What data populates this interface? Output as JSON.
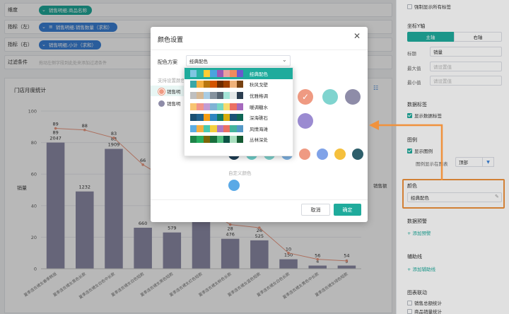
{
  "fields": {
    "dimension": {
      "label": "维度",
      "pill": "销售明细.商品名称"
    },
    "metric_left": {
      "label": "指标（左）",
      "pill": "销售明细.销售数量（求和）"
    },
    "metric_right": {
      "label": "指标（右）",
      "pill": "销售明细.小计（求和）"
    },
    "filter": {
      "label": "过滤条件",
      "placeholder": "拖动左侧字段到此处来添加过滤条件"
    }
  },
  "chart_data": {
    "type": "bar",
    "title": "门店月度统计",
    "categories": [
      "夏季连衣裙女春季韩版",
      "夏季连衣裙女黑色长款",
      "夏季连衣裙女白色中长款",
      "夏季连衣裙女白色短款",
      "夏季连衣裙女黑色短款",
      "夏季连衣裙女红色短款",
      "夏季连衣裙女粉色长款",
      "夏季连衣裙女蓝色短款",
      "夏季连衣裙女白色长款",
      "夏季连衣裙女黄色中长款",
      "夏季连衣裙女绿色短款"
    ],
    "series": [
      {
        "name": "销量",
        "values": [
          80,
          49,
          76,
          26,
          23,
          35,
          19,
          18,
          6,
          2,
          2
        ],
        "axis": "left",
        "color": "#8e8ca8"
      },
      {
        "name": "销售额",
        "values": [
          89,
          88,
          83,
          66,
          55,
          40,
          28,
          26,
          10,
          6,
          5
        ],
        "axis": "right",
        "color": "#ef9a82"
      }
    ],
    "bar_labels": [
      "89\n2047",
      "1232",
      "83\n1909",
      "660",
      "579",
      "",
      "28\n476",
      "26\n525",
      "10\n150",
      "56\n4",
      "54\n3"
    ],
    "line_labels": [
      "89",
      "88",
      "83",
      "66",
      "",
      "",
      "",
      "",
      "",
      "",
      ""
    ],
    "ylabel_left": "销量",
    "ylabel_right": "销售额",
    "ylim": [
      0,
      100
    ],
    "yticks": [
      "0",
      "20",
      "40",
      "60",
      "80",
      "100"
    ],
    "grid": true
  },
  "sidebar": {
    "force_label": "强制显示所有标签",
    "y_axis_title": "坐标Y轴",
    "tab_main": "主轴",
    "tab_sub": "右轴",
    "title_label": "标题",
    "title_value": "销量",
    "max_label": "最大值",
    "max_placeholder": "请设置值",
    "min_label": "最小值",
    "min_placeholder": "请设置值",
    "data_label_title": "数据标签",
    "show_data_label": "显示数据标签",
    "legend_title": "图例",
    "show_legend": "显示图例",
    "legend_pos_label": "图例显示在图表",
    "legend_pos_value": "顶部",
    "color_title": "颜色",
    "color_value": "经典配色",
    "warning_title": "数据预警",
    "add_warning": "+ 添加预警",
    "guide_title": "辅助线",
    "add_guide": "+ 添加辅助线",
    "link_title": "图表联动",
    "link_items": [
      "销售总额统计",
      "商品销量统计"
    ]
  },
  "dialog": {
    "title": "颜色设置",
    "scheme_label": "配色方案",
    "scheme_value": "经典配色",
    "series_hint": "支持设置颜色",
    "series": [
      "销售明",
      "销售明"
    ],
    "custom_label": "自定义颜色",
    "cancel": "取消",
    "ok": "确定"
  },
  "palette_options": [
    {
      "name": "经典配色",
      "colors": [
        "#7fc6e3",
        "#2bb3a5",
        "#ffcc33",
        "#4aa3df",
        "#9b59b6",
        "#e9a0a0",
        "#f08a5d",
        "#6a5acd"
      ]
    },
    {
      "name": "秋风戈壁",
      "colors": [
        "#3aa7a7",
        "#f5b041",
        "#b9770e",
        "#d35400",
        "#6e2c00",
        "#a04000",
        "#f0b27a",
        "#784212"
      ]
    },
    {
      "name": "优雅格调",
      "colors": [
        "#bfbfbf",
        "#d5b895",
        "#a9cce3",
        "#85929e",
        "#566573",
        "#a3e4d7",
        "#e5e8e8",
        "#2c3e50"
      ]
    },
    {
      "name": "暖调糖水",
      "colors": [
        "#f8c471",
        "#f1948a",
        "#c39bd3",
        "#7fb3d5",
        "#76d7c4",
        "#f7dc6f",
        "#ec7063",
        "#a569bd"
      ]
    },
    {
      "name": "深海礁石",
      "colors": [
        "#1b4f72",
        "#21618c",
        "#f39c12",
        "#2e86c1",
        "#117a65",
        "#d4ac0d",
        "#1a5276",
        "#0e6655"
      ]
    },
    {
      "name": "风情海滩",
      "colors": [
        "#5dade2",
        "#f5b041",
        "#48c9b0",
        "#f4d03f",
        "#af7ac5",
        "#ec7063",
        "#45b39d",
        "#5499c7"
      ]
    },
    {
      "name": "丛林深处",
      "colors": [
        "#1e8449",
        "#27ae60",
        "#7d6608",
        "#196f3d",
        "#52be80",
        "#0b5345",
        "#a9dfbf",
        "#145a32"
      ]
    }
  ],
  "swatch_colors": {
    "row1": [
      "#ef9a82",
      "#7fd4cf",
      "#8e8ca8"
    ],
    "row2": [
      "#9b8bd1"
    ],
    "row3": [
      "#1f3f55",
      "#6fd0cb",
      "#7fd4cf",
      "#7fb3e3",
      "#ef9a82",
      "#7fa2e8",
      "#f5c03d",
      "#2e5f6b"
    ],
    "custom": [
      "#5aa9e6"
    ],
    "series_dots": [
      "#ef9a82",
      "#8e8ca8"
    ]
  }
}
